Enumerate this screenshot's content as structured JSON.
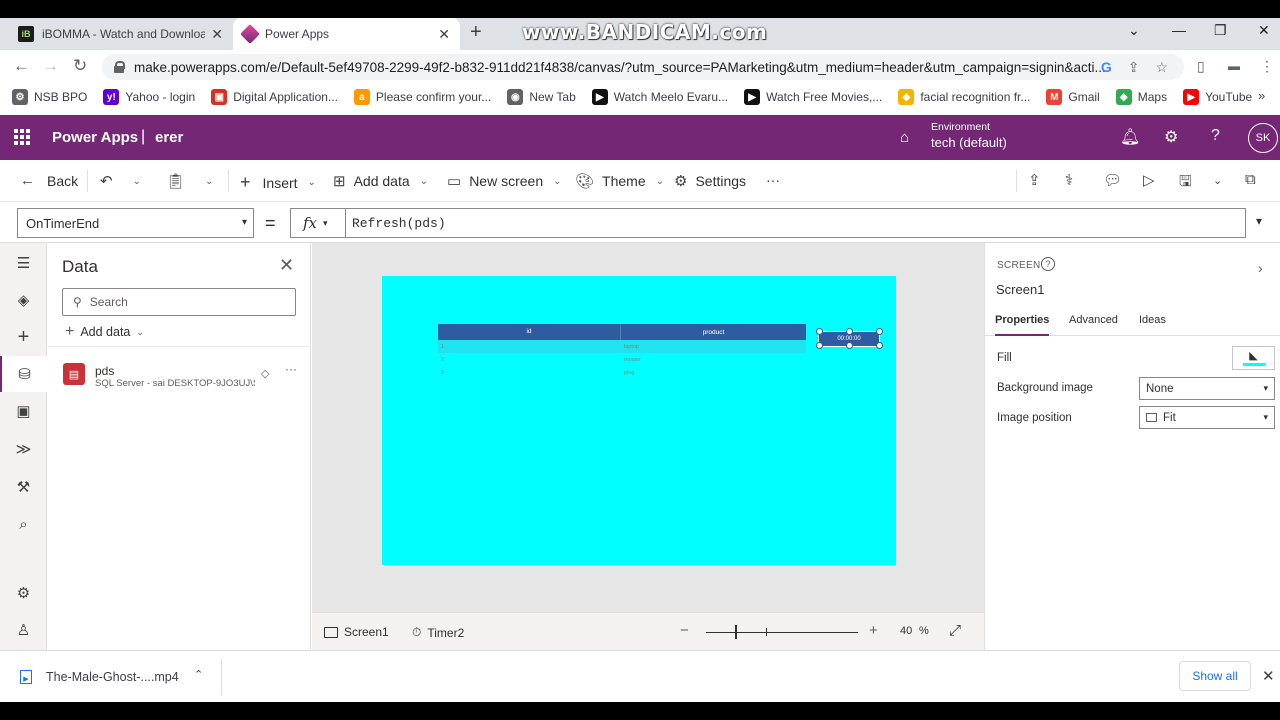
{
  "browser": {
    "tabs": [
      {
        "title": "iBOMMA - Watch and Download",
        "favicon": "iB"
      },
      {
        "title": "Power Apps"
      }
    ],
    "watermark": "www.BANDICAM.com",
    "url": "make.powerapps.com/e/Default-5ef49708-2299-49f2-b832-911dd21f4838/canvas/?utm_source=PAMarketing&utm_medium=header&utm_campaign=signin&acti...",
    "bookmarks": [
      {
        "label": "NSB BPO",
        "color": "#5f6368"
      },
      {
        "label": "Yahoo - login",
        "color": "#6001d2"
      },
      {
        "label": "Digital Application...",
        "color": "#d93025"
      },
      {
        "label": "Please confirm your...",
        "color": "#ff9900"
      },
      {
        "label": "New Tab",
        "color": "#5f6368"
      },
      {
        "label": "Watch Meelo Evaru...",
        "color": "#111111"
      },
      {
        "label": "Watch Free Movies,...",
        "color": "#111111"
      },
      {
        "label": "facial recognition fr...",
        "color": "#f4b400"
      },
      {
        "label": "Gmail",
        "color": "#ea4335"
      },
      {
        "label": "Maps",
        "color": "#34a853"
      },
      {
        "label": "YouTube",
        "color": "#ff0000"
      }
    ]
  },
  "header": {
    "app": "Power Apps",
    "separator": "|",
    "app_name": "erer",
    "env_label": "Environment",
    "env_value": "tech (default)",
    "avatar": "SK",
    "accent": "#742774"
  },
  "commands": {
    "back": "Back",
    "insert": "Insert",
    "add_data": "Add data",
    "new_screen": "New screen",
    "theme": "Theme",
    "settings": "Settings",
    "more": "···"
  },
  "formula": {
    "property": "OnTimerEnd",
    "equals": "=",
    "fx": "fx",
    "expression": "Refresh(pds)"
  },
  "data_pane": {
    "title": "Data",
    "search_placeholder": "Search",
    "add_data": "Add data",
    "sources": [
      {
        "name": "pds",
        "subtitle": "SQL Server - sai DESKTOP-9JO3UJ\\S..."
      }
    ]
  },
  "canvas": {
    "screen_fill": "#00ffff",
    "gallery": {
      "headers": [
        "id",
        "product"
      ],
      "rows": [
        [
          "1",
          "laptop"
        ],
        [
          "2",
          "mouse"
        ],
        [
          "3",
          "plug"
        ]
      ]
    },
    "timer_text": "00:00:00"
  },
  "statusbar": {
    "crumbs": [
      "Screen1",
      "Timer2"
    ],
    "zoom_value": "40",
    "zoom_unit": "%"
  },
  "properties": {
    "kind": "SCREEN",
    "name": "Screen1",
    "tabs": [
      "Properties",
      "Advanced",
      "Ideas"
    ],
    "fill_label": "Fill",
    "bg_image_label": "Background image",
    "bg_image_value": "None",
    "img_pos_label": "Image position",
    "img_pos_value": "Fit"
  },
  "downloads": {
    "file": "The-Male-Ghost-....mp4",
    "show_all": "Show all"
  }
}
